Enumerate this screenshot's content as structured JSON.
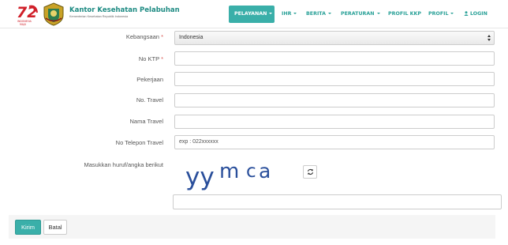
{
  "header": {
    "logo_text": "72",
    "logo_sub": "INDONESIA MAJU",
    "brand_title": "Kantor Kesehatan Pelabuhan",
    "brand_subtitle": "Kementerian Kesehatan Republik Indonesia",
    "brand_color": "#1e8b83"
  },
  "nav": {
    "items": [
      {
        "label": "PELAYANAN",
        "active": true,
        "dropdown": true
      },
      {
        "label": "IHR",
        "dropdown": true
      },
      {
        "label": "BERITA",
        "dropdown": true
      },
      {
        "label": "PERATURAN",
        "dropdown": true
      },
      {
        "label": "PROFIL KKP",
        "dropdown": false
      },
      {
        "label": "PROFIL",
        "dropdown": true
      },
      {
        "label": "LOGIN",
        "icon": "user-icon",
        "dropdown": false
      }
    ],
    "accent_color": "#3aafa9"
  },
  "form": {
    "fields": [
      {
        "label": "Kebangsaan",
        "required": true,
        "type": "select",
        "value": "Indonesia"
      },
      {
        "label": "No KTP",
        "required": true,
        "type": "text",
        "value": ""
      },
      {
        "label": "Pekerjaan",
        "required": false,
        "type": "text",
        "value": ""
      },
      {
        "label": "No. Travel",
        "required": false,
        "type": "text",
        "value": ""
      },
      {
        "label": "Nama Travel",
        "required": false,
        "type": "text",
        "value": ""
      },
      {
        "label": "No Telepon Travel",
        "required": false,
        "type": "text",
        "value": "",
        "placeholder": "exp : 022xxxxxx"
      }
    ],
    "required_mark": "*",
    "captcha_label": "Masukkan huruf/angka berikut",
    "captcha_text": "yymca",
    "captcha_color": "#2a4f9b",
    "refresh_icon": "refresh-icon",
    "captcha_value": ""
  },
  "actions": {
    "submit_label": "Kirim",
    "cancel_label": "Batal"
  }
}
